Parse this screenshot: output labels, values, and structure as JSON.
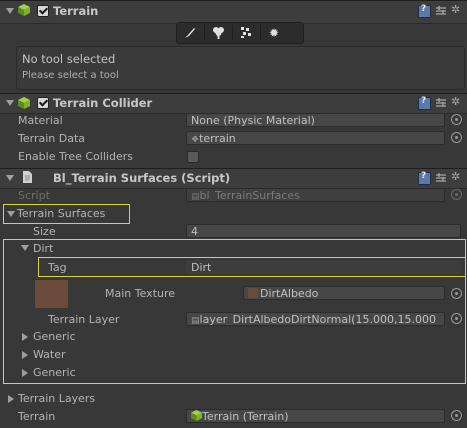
{
  "terrain": {
    "title": "Terrain",
    "tools": [
      "paint-brush-icon",
      "tree-icon",
      "detail-icon",
      "settings-gear-icon"
    ],
    "status_line1": "No tool selected",
    "status_line2": "Please select a tool"
  },
  "collider": {
    "title": "Terrain Collider",
    "material_label": "Material",
    "material_value": "None (Physic Material)",
    "data_label": "Terrain Data",
    "data_value": "terrain",
    "trees_label": "Enable Tree Colliders"
  },
  "script": {
    "title": "Bl_Terrain Surfaces (Script)",
    "script_label": "Script",
    "script_value": "bl_TerrainSurfaces",
    "surfaces_label": "Terrain Surfaces",
    "size_label": "Size",
    "size_value": "4",
    "dirt_label": "Dirt",
    "tag_label": "Tag",
    "tag_value": "Dirt",
    "main_texture_label": "Main Texture",
    "main_texture_value": "DirtAlbedo",
    "terrain_layer_label": "Terrain Layer",
    "terrain_layer_value": "layer_DirtAlbedoDirtNormal(15.000,15.000",
    "items": [
      "Generic",
      "Water",
      "Generic"
    ],
    "layers_label": "Terrain Layers",
    "terrain_label": "Terrain",
    "terrain_value": "Terrain (Terrain)"
  },
  "colors": {
    "highlight": "#d6d63c",
    "dirt_swatch": "#6a4a3a"
  }
}
